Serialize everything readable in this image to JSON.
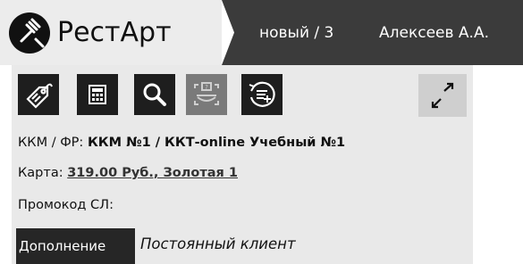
{
  "header": {
    "app_title": "РестАрт",
    "order_label": "новый / 3",
    "waiter_name": "Алексеев А.А."
  },
  "toolbar": {
    "icons": [
      "discount-tag-icon",
      "calculator-icon",
      "search-icon",
      "unknown-dish-icon",
      "add-to-list-icon",
      "expand-icon"
    ]
  },
  "info": {
    "kkm_label": "ККМ / ФР:",
    "kkm_value": "ККМ №1 / ККТ-online Учебный №1",
    "card_label": "Карта:",
    "card_value": "319.00 Руб., Золотая 1",
    "promo_label": "Промокод СЛ:",
    "addition_label": "Дополнение",
    "addition_value": "Постоянный клиент"
  },
  "colors": {
    "header_dark": "#3b3b3b",
    "toolbar_button": "#1e1e1e",
    "panel_bg": "#e9e9e9"
  }
}
